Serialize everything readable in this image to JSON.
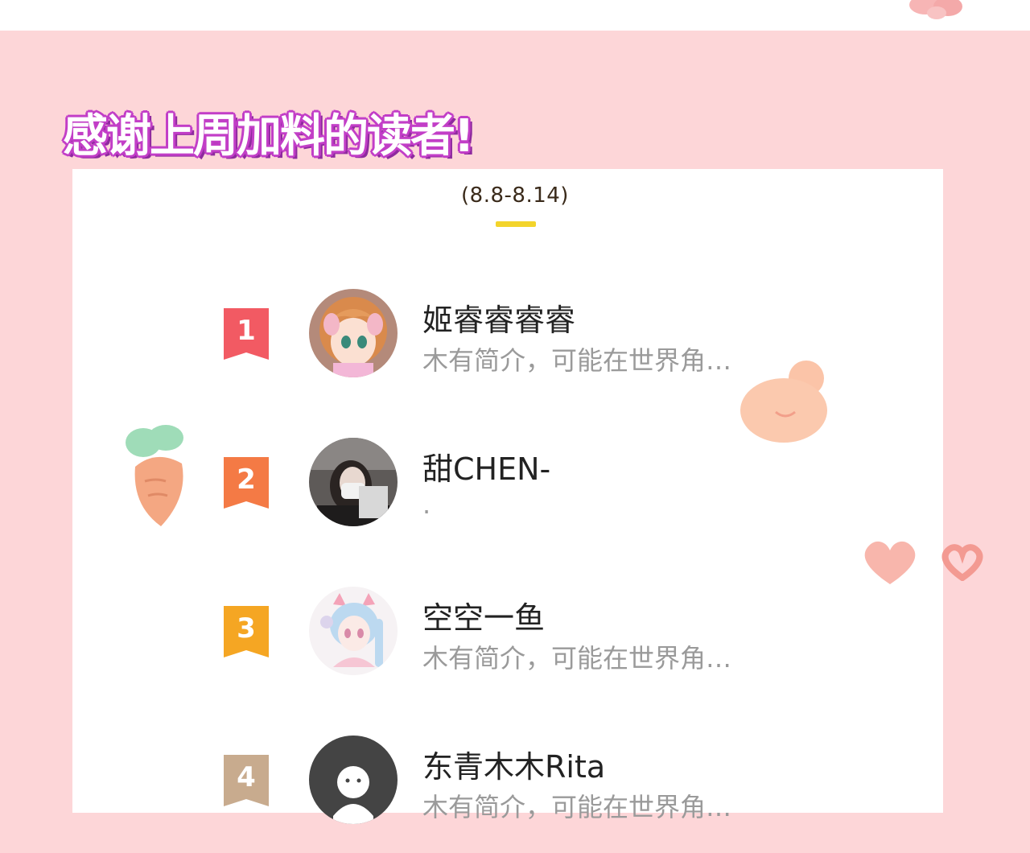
{
  "banner": {
    "title": "感谢上周加料的读者!"
  },
  "ranking": {
    "date_range": "(8.8-8.14)",
    "entries": [
      {
        "rank": "1",
        "name": "姬睿睿睿睿",
        "bio": "木有简介，可能在世界角…",
        "badge_color": "#f25a63",
        "avatar": "anime-girl-avatar"
      },
      {
        "rank": "2",
        "name": "甜CHEN-",
        "bio": ".",
        "badge_color": "#f47a45",
        "avatar": "photo-avatar"
      },
      {
        "rank": "3",
        "name": "空空一鱼",
        "bio": "木有简介，可能在世界角…",
        "badge_color": "#f5a623",
        "avatar": "anime-catgirl-avatar"
      },
      {
        "rank": "4",
        "name": "东青木木Rita",
        "bio": "木有简介，可能在世界角…",
        "badge_color": "#c8ab8e",
        "avatar": "default-ghost-avatar"
      }
    ]
  },
  "colors": {
    "background": "#fdd6d8",
    "title_outline": "#c23ec7",
    "tab_indicator": "#f3d42b"
  }
}
